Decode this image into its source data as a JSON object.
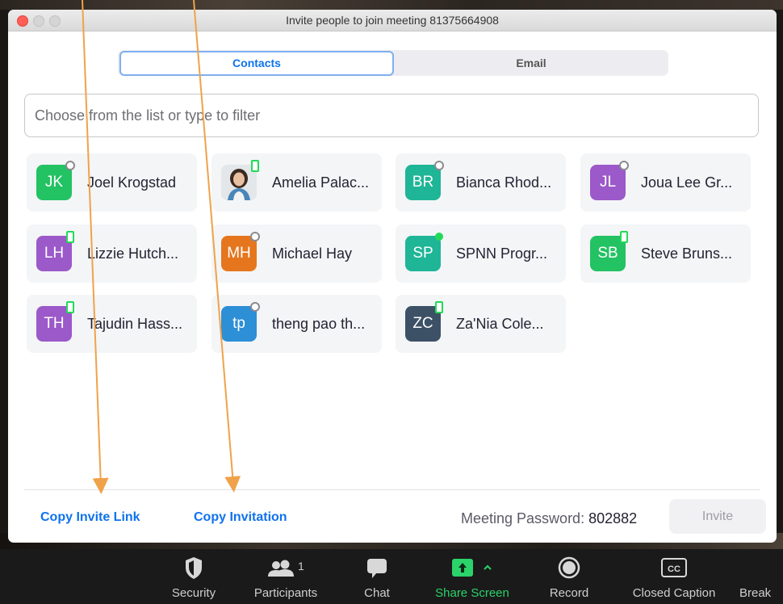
{
  "window": {
    "title": "Invite people to join meeting 81375664908"
  },
  "tabs": [
    {
      "label": "Contacts",
      "active": true
    },
    {
      "label": "Email",
      "active": false
    }
  ],
  "filter": {
    "placeholder": "Choose from the list or type to filter"
  },
  "contacts": [
    {
      "initials": "JK",
      "name": "Joel Krogstad",
      "color": "#23c263",
      "status": "offline"
    },
    {
      "initials": "",
      "name": "Amelia Palac...",
      "color": "#d9dee3",
      "status": "mobile"
    },
    {
      "initials": "BR",
      "name": "Bianca Rhod...",
      "color": "#1fb597",
      "status": "offline"
    },
    {
      "initials": "JL",
      "name": "Joua Lee Gr...",
      "color": "#9b59c9",
      "status": "offline"
    },
    {
      "initials": "LH",
      "name": "Lizzie Hutch...",
      "color": "#9b59c9",
      "status": "mobile"
    },
    {
      "initials": "MH",
      "name": "Michael Hay",
      "color": "#e5761e",
      "status": "offline"
    },
    {
      "initials": "SP",
      "name": "SPNN Progr...",
      "color": "#1fb597",
      "status": "online"
    },
    {
      "initials": "SB",
      "name": "Steve Bruns...",
      "color": "#23c263",
      "status": "mobile"
    },
    {
      "initials": "TH",
      "name": "Tajudin Hass...",
      "color": "#9b59c9",
      "status": "mobile"
    },
    {
      "initials": "tp",
      "name": "theng pao th...",
      "color": "#2d8fd6",
      "status": "offline"
    },
    {
      "initials": "ZC",
      "name": "Za'Nia  Cole...",
      "color": "#3d5166",
      "status": "mobile"
    }
  ],
  "footer": {
    "copy_invite_link": "Copy Invite Link",
    "copy_invitation": "Copy Invitation",
    "password_label": "Meeting Password:",
    "password_value": "802882",
    "invite_button": "Invite"
  },
  "toolbar": {
    "security": "Security",
    "participants": "Participants",
    "participants_count": "1",
    "chat": "Chat",
    "share_screen": "Share Screen",
    "record": "Record",
    "closed_caption": "Closed Caption",
    "cc_glyph": "CC",
    "breakout": "Break"
  },
  "colors": {
    "accent": "#0e72ed",
    "share_green": "#2bd36a",
    "annotation_arrow": "#f0a24a"
  }
}
